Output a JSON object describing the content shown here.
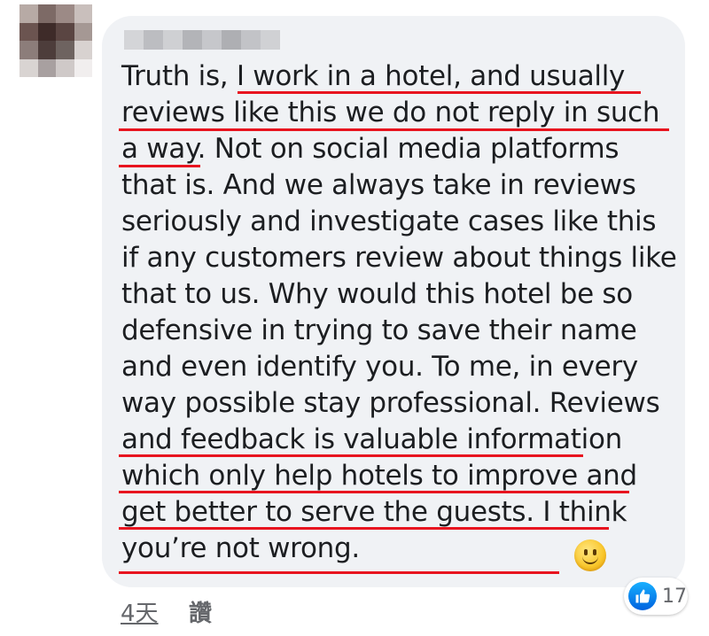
{
  "comment": {
    "text": "Truth is, I work in a hotel, and usually reviews like this we do not reply in such a way. Not on social media platforms that is. And we always take in reviews seriously and investigate cases like this if any customers review about things like that to us. Why would this hotel be so defensive in trying to save their name and even identify you. To me, in every way possible stay professional. Reviews and feedback is valuable information which only help hotels to improve and get better to serve the guests. I think you’re not wrong.",
    "emoji": "slightly-smiling-face-icon"
  },
  "reactions": {
    "icon": "thumbs-up-icon",
    "count": "17"
  },
  "footer": {
    "time": "4天",
    "like_label": "讚"
  },
  "colors": {
    "bubble": "#f0f2f5",
    "text": "#1c1e21",
    "meta": "#65676b",
    "annotation_underline": "#e8141f",
    "like_blue": "#1877f2"
  }
}
